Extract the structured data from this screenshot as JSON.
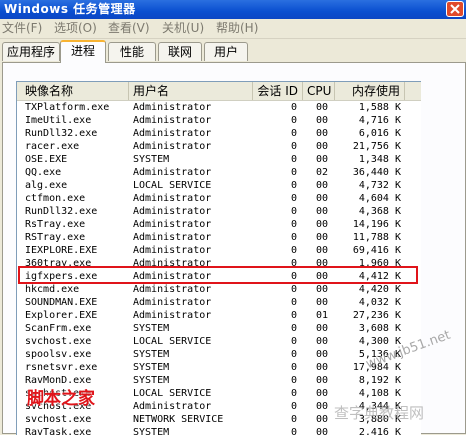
{
  "window": {
    "title": "Windows 任务管理器",
    "close_label": "×"
  },
  "menu": [
    "文件(F)",
    "选项(O)",
    "查看(V)",
    "关机(U)",
    "帮助(H)"
  ],
  "tabs": [
    {
      "label": "应用程序",
      "active": false
    },
    {
      "label": "进程",
      "active": true
    },
    {
      "label": "性能",
      "active": false
    },
    {
      "label": "联网",
      "active": false
    },
    {
      "label": "用户",
      "active": false
    }
  ],
  "columns": {
    "name": "映像名称",
    "user": "用户名",
    "session": "会话 ID",
    "cpu": "CPU",
    "mem": "内存使用"
  },
  "processes": [
    {
      "name": "TXPlatform.exe",
      "user": "Administrator",
      "session": "0",
      "cpu": "00",
      "mem": "1,588 K"
    },
    {
      "name": "ImeUtil.exe",
      "user": "Administrator",
      "session": "0",
      "cpu": "00",
      "mem": "4,716 K"
    },
    {
      "name": "RunDll32.exe",
      "user": "Administrator",
      "session": "0",
      "cpu": "00",
      "mem": "6,016 K"
    },
    {
      "name": "racer.exe",
      "user": "Administrator",
      "session": "0",
      "cpu": "00",
      "mem": "21,756 K"
    },
    {
      "name": "OSE.EXE",
      "user": "SYSTEM",
      "session": "0",
      "cpu": "00",
      "mem": "1,348 K"
    },
    {
      "name": "QQ.exe",
      "user": "Administrator",
      "session": "0",
      "cpu": "02",
      "mem": "36,440 K"
    },
    {
      "name": "alg.exe",
      "user": "LOCAL SERVICE",
      "session": "0",
      "cpu": "00",
      "mem": "4,732 K"
    },
    {
      "name": "ctfmon.exe",
      "user": "Administrator",
      "session": "0",
      "cpu": "00",
      "mem": "4,604 K"
    },
    {
      "name": "RunDll32.exe",
      "user": "Administrator",
      "session": "0",
      "cpu": "00",
      "mem": "4,368 K"
    },
    {
      "name": "RsTray.exe",
      "user": "Administrator",
      "session": "0",
      "cpu": "00",
      "mem": "14,196 K"
    },
    {
      "name": "RSTray.exe",
      "user": "Administrator",
      "session": "0",
      "cpu": "00",
      "mem": "11,788 K"
    },
    {
      "name": "IEXPLORE.EXE",
      "user": "Administrator",
      "session": "0",
      "cpu": "00",
      "mem": "69,416 K"
    },
    {
      "name": "360tray.exe",
      "user": "Administrator",
      "session": "0",
      "cpu": "00",
      "mem": "1,960 K"
    },
    {
      "name": "igfxpers.exe",
      "user": "Administrator",
      "session": "0",
      "cpu": "00",
      "mem": "4,412 K"
    },
    {
      "name": "hkcmd.exe",
      "user": "Administrator",
      "session": "0",
      "cpu": "00",
      "mem": "4,420 K"
    },
    {
      "name": "SOUNDMAN.EXE",
      "user": "Administrator",
      "session": "0",
      "cpu": "00",
      "mem": "4,032 K"
    },
    {
      "name": "Explorer.EXE",
      "user": "Administrator",
      "session": "0",
      "cpu": "01",
      "mem": "27,236 K"
    },
    {
      "name": "ScanFrm.exe",
      "user": "SYSTEM",
      "session": "0",
      "cpu": "00",
      "mem": "3,608 K"
    },
    {
      "name": "svchost.exe",
      "user": "LOCAL SERVICE",
      "session": "0",
      "cpu": "00",
      "mem": "4,300 K"
    },
    {
      "name": "spoolsv.exe",
      "user": "SYSTEM",
      "session": "0",
      "cpu": "00",
      "mem": "5,136 K"
    },
    {
      "name": "rsnetsvr.exe",
      "user": "SYSTEM",
      "session": "0",
      "cpu": "00",
      "mem": "17,984 K"
    },
    {
      "name": "RavMonD.exe",
      "user": "SYSTEM",
      "session": "0",
      "cpu": "00",
      "mem": "8,192 K"
    },
    {
      "name": "svchost.exe",
      "user": "LOCAL SERVICE",
      "session": "0",
      "cpu": "00",
      "mem": "4,108 K"
    },
    {
      "name": "svchost.exe",
      "user": "Administrator",
      "session": "0",
      "cpu": "00",
      "mem": "4,344 K"
    },
    {
      "name": "svchost.exe",
      "user": "NETWORK SERVICE",
      "session": "0",
      "cpu": "00",
      "mem": "3,880 K"
    },
    {
      "name": "RavTask.exe",
      "user": "SYSTEM",
      "session": "0",
      "cpu": "00",
      "mem": "2,416 K"
    }
  ],
  "highlighted_process": "igfxpers.exe",
  "watermarks": {
    "left": "脚本之家",
    "right_url": "www.jb51.net",
    "right_cn": "查字典教程网"
  },
  "colors": {
    "titlebar": "#0a4fd0",
    "highlight_border": "#e0141a",
    "active_tab_accent": "#f8b332"
  }
}
